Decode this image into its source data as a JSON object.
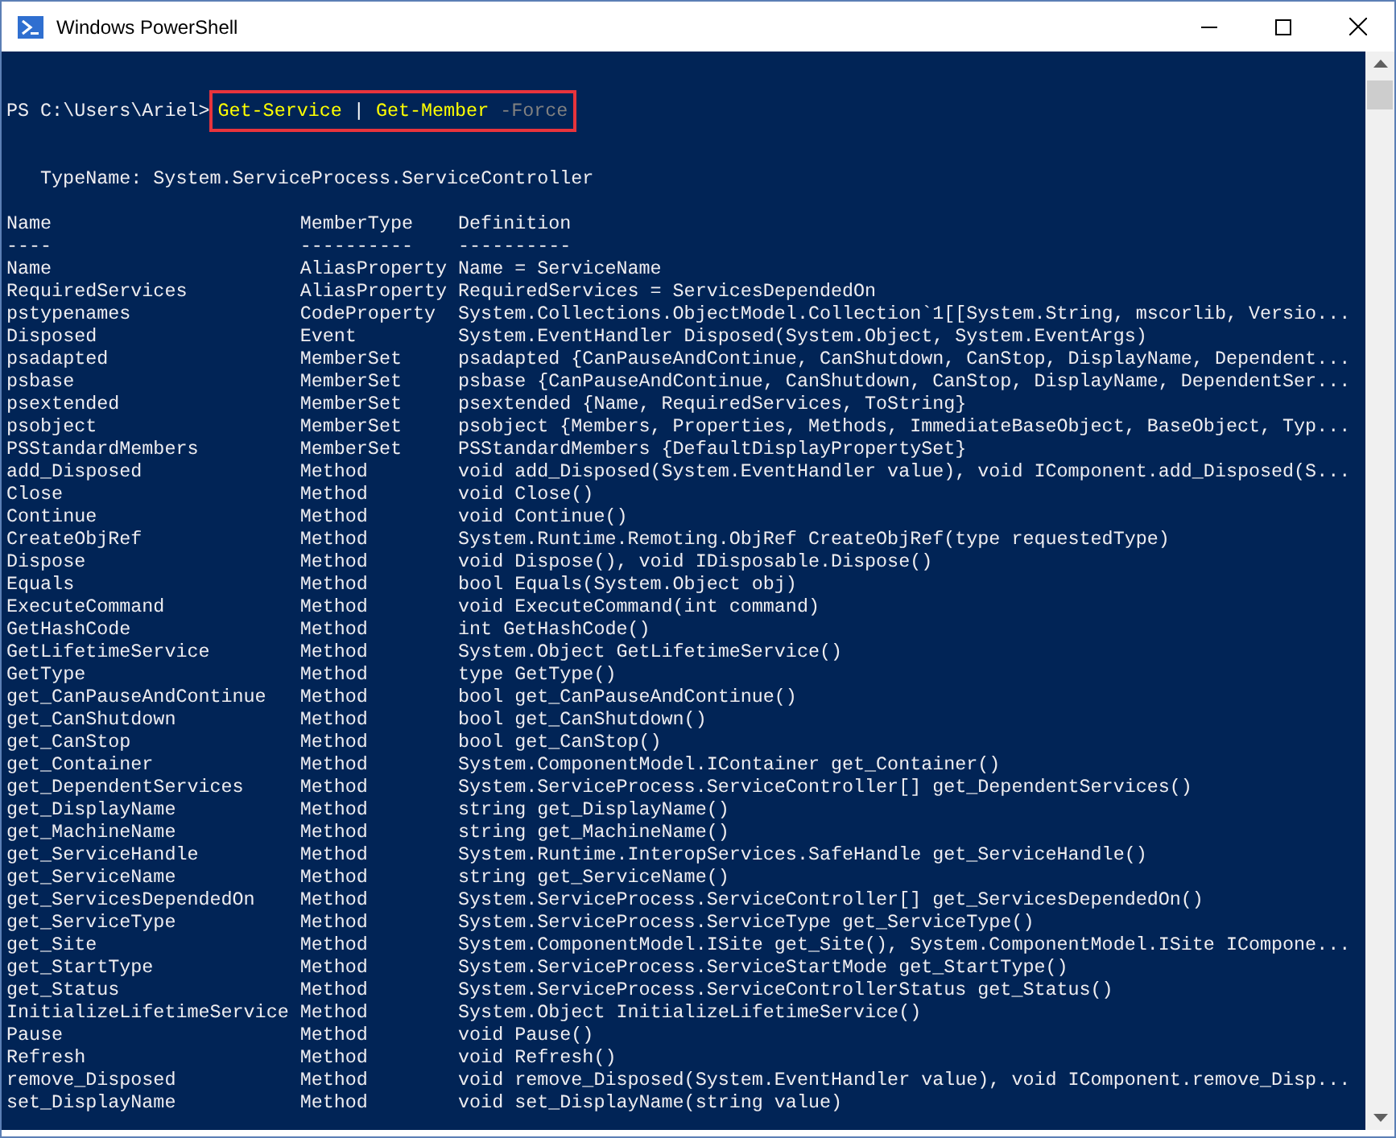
{
  "window": {
    "title": "Windows PowerShell"
  },
  "prompt": "PS C:\\Users\\Ariel>",
  "command": {
    "highlighted": true,
    "parts": [
      {
        "kind": "cmdlet",
        "text": "Get-Service"
      },
      {
        "kind": "operator",
        "text": "|"
      },
      {
        "kind": "cmdlet",
        "text": "Get-Member"
      },
      {
        "kind": "parameter",
        "text": "-Force"
      }
    ]
  },
  "type_name": "TypeName: System.ServiceProcess.ServiceController",
  "table": {
    "columns": [
      "Name",
      "MemberType",
      "Definition"
    ],
    "underlines": [
      "----",
      "----------",
      "----------"
    ],
    "rows": [
      {
        "name": "Name",
        "member_type": "AliasProperty",
        "definition": "Name = ServiceName"
      },
      {
        "name": "RequiredServices",
        "member_type": "AliasProperty",
        "definition": "RequiredServices = ServicesDependedOn"
      },
      {
        "name": "pstypenames",
        "member_type": "CodeProperty",
        "definition": "System.Collections.ObjectModel.Collection`1[[System.String, mscorlib, Versio..."
      },
      {
        "name": "Disposed",
        "member_type": "Event",
        "definition": "System.EventHandler Disposed(System.Object, System.EventArgs)"
      },
      {
        "name": "psadapted",
        "member_type": "MemberSet",
        "definition": "psadapted {CanPauseAndContinue, CanShutdown, CanStop, DisplayName, Dependent..."
      },
      {
        "name": "psbase",
        "member_type": "MemberSet",
        "definition": "psbase {CanPauseAndContinue, CanShutdown, CanStop, DisplayName, DependentSer..."
      },
      {
        "name": "psextended",
        "member_type": "MemberSet",
        "definition": "psextended {Name, RequiredServices, ToString}"
      },
      {
        "name": "psobject",
        "member_type": "MemberSet",
        "definition": "psobject {Members, Properties, Methods, ImmediateBaseObject, BaseObject, Typ..."
      },
      {
        "name": "PSStandardMembers",
        "member_type": "MemberSet",
        "definition": "PSStandardMembers {DefaultDisplayPropertySet}"
      },
      {
        "name": "add_Disposed",
        "member_type": "Method",
        "definition": "void add_Disposed(System.EventHandler value), void IComponent.add_Disposed(S..."
      },
      {
        "name": "Close",
        "member_type": "Method",
        "definition": "void Close()"
      },
      {
        "name": "Continue",
        "member_type": "Method",
        "definition": "void Continue()"
      },
      {
        "name": "CreateObjRef",
        "member_type": "Method",
        "definition": "System.Runtime.Remoting.ObjRef CreateObjRef(type requestedType)"
      },
      {
        "name": "Dispose",
        "member_type": "Method",
        "definition": "void Dispose(), void IDisposable.Dispose()"
      },
      {
        "name": "Equals",
        "member_type": "Method",
        "definition": "bool Equals(System.Object obj)"
      },
      {
        "name": "ExecuteCommand",
        "member_type": "Method",
        "definition": "void ExecuteCommand(int command)"
      },
      {
        "name": "GetHashCode",
        "member_type": "Method",
        "definition": "int GetHashCode()"
      },
      {
        "name": "GetLifetimeService",
        "member_type": "Method",
        "definition": "System.Object GetLifetimeService()"
      },
      {
        "name": "GetType",
        "member_type": "Method",
        "definition": "type GetType()"
      },
      {
        "name": "get_CanPauseAndContinue",
        "member_type": "Method",
        "definition": "bool get_CanPauseAndContinue()"
      },
      {
        "name": "get_CanShutdown",
        "member_type": "Method",
        "definition": "bool get_CanShutdown()"
      },
      {
        "name": "get_CanStop",
        "member_type": "Method",
        "definition": "bool get_CanStop()"
      },
      {
        "name": "get_Container",
        "member_type": "Method",
        "definition": "System.ComponentModel.IContainer get_Container()"
      },
      {
        "name": "get_DependentServices",
        "member_type": "Method",
        "definition": "System.ServiceProcess.ServiceController[] get_DependentServices()"
      },
      {
        "name": "get_DisplayName",
        "member_type": "Method",
        "definition": "string get_DisplayName()"
      },
      {
        "name": "get_MachineName",
        "member_type": "Method",
        "definition": "string get_MachineName()"
      },
      {
        "name": "get_ServiceHandle",
        "member_type": "Method",
        "definition": "System.Runtime.InteropServices.SafeHandle get_ServiceHandle()"
      },
      {
        "name": "get_ServiceName",
        "member_type": "Method",
        "definition": "string get_ServiceName()"
      },
      {
        "name": "get_ServicesDependedOn",
        "member_type": "Method",
        "definition": "System.ServiceProcess.ServiceController[] get_ServicesDependedOn()"
      },
      {
        "name": "get_ServiceType",
        "member_type": "Method",
        "definition": "System.ServiceProcess.ServiceType get_ServiceType()"
      },
      {
        "name": "get_Site",
        "member_type": "Method",
        "definition": "System.ComponentModel.ISite get_Site(), System.ComponentModel.ISite ICompone..."
      },
      {
        "name": "get_StartType",
        "member_type": "Method",
        "definition": "System.ServiceProcess.ServiceStartMode get_StartType()"
      },
      {
        "name": "get_Status",
        "member_type": "Method",
        "definition": "System.ServiceProcess.ServiceControllerStatus get_Status()"
      },
      {
        "name": "InitializeLifetimeService",
        "member_type": "Method",
        "definition": "System.Object InitializeLifetimeService()"
      },
      {
        "name": "Pause",
        "member_type": "Method",
        "definition": "void Pause()"
      },
      {
        "name": "Refresh",
        "member_type": "Method",
        "definition": "void Refresh()"
      },
      {
        "name": "remove_Disposed",
        "member_type": "Method",
        "definition": "void remove_Disposed(System.EventHandler value), void IComponent.remove_Disp..."
      },
      {
        "name": "set_DisplayName",
        "member_type": "Method",
        "definition": "void set_DisplayName(string value)"
      }
    ]
  }
}
